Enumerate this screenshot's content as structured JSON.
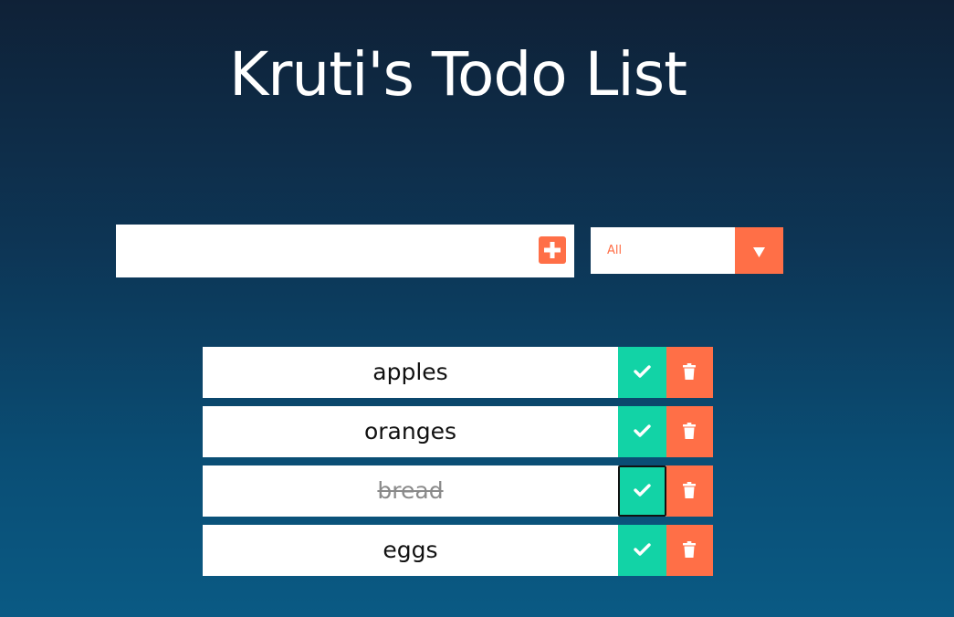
{
  "header": {
    "title": "Kruti's Todo List"
  },
  "add_form": {
    "input_value": "",
    "input_placeholder": "",
    "add_icon": "plus-square-icon"
  },
  "filter": {
    "selected": "All",
    "arrow_icon": "caret-down-icon"
  },
  "todos": [
    {
      "text": "apples",
      "completed": false
    },
    {
      "text": "oranges",
      "completed": false
    },
    {
      "text": "bread",
      "completed": true
    },
    {
      "text": "eggs",
      "completed": false
    }
  ],
  "colors": {
    "accent": "#ff6f47",
    "check": "#12d3a6",
    "bg_top": "#0f2137",
    "bg_bottom": "#0a5a84"
  }
}
